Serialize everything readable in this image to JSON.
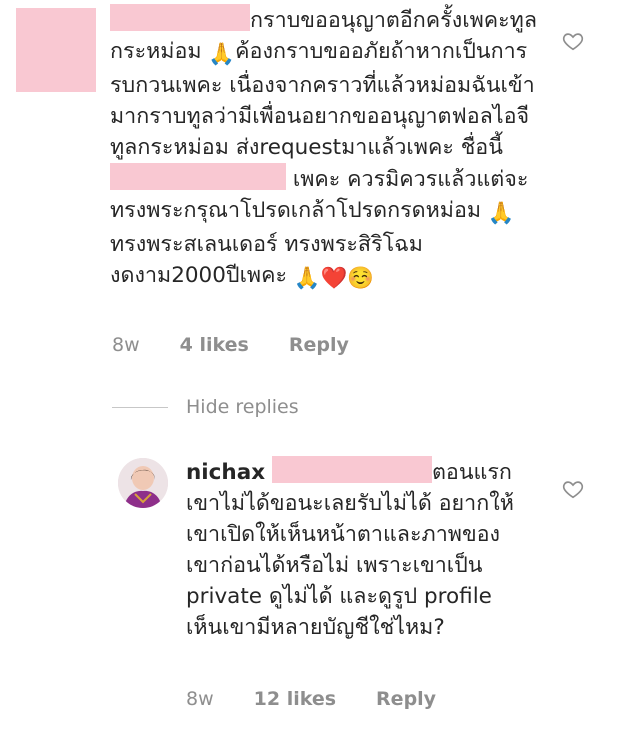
{
  "colors": {
    "redaction": "#f9c8d2",
    "text": "#262626",
    "meta": "#8e8e8e",
    "heart_red": "#e0245e"
  },
  "icons": {
    "like": "heart-outline-icon",
    "pray": "folded-hands-emoji",
    "red_heart": "red-heart-emoji",
    "smile": "smiling-face-emoji"
  },
  "comment": {
    "text_part1": "กราบขออนุญาตอีกครั้งเพคะทูลกระหม่อม ",
    "pray1": "🙏",
    "text_part2": "ค้องกราบขออภัยถ้าหากเป็นการรบกวนเพคะ เนื่องจากคราวที่แล้วหม่อมฉันเข้ามากราบทูลว่ามีเพื่อนอยากขออนุญาตฟอลไอจีทูลกระหม่อม ส่งrequestมาแล้วเพคะ ชื่อนี้ ",
    "text_part3": "เพคะ ควรมิควรแล้วแต่จะทรงพระกรุณาโปรดเกล้าโปรดกรดหม่อม ",
    "pray2": "🙏",
    "text_part4": " ทรงพระสเลนเดอร์ ทรงพระสิริโฉมงดงาม2000ปีเพคะ ",
    "pray3": "🙏",
    "heart": "❤️",
    "smile": "☺️",
    "time": "8w",
    "likes": "4 likes",
    "reply": "Reply"
  },
  "thread": {
    "hide_replies": "Hide replies"
  },
  "reply_comment": {
    "username": "nichax",
    "text_part1": "ตอนแรกเขาไม่ได้ขอนะเลยรับไม่ได้ อยากให้เขาเปิดให้เห็นหน้าตาและภาพของเขาก่อนได้หรือไม่ เพราะเขาเป็น private ดูไม่ได้ และดูรูป profile เห็นเขามีหลายบัญชีใช่ไหม?",
    "time": "8w",
    "likes": "12 likes",
    "reply": "Reply"
  }
}
